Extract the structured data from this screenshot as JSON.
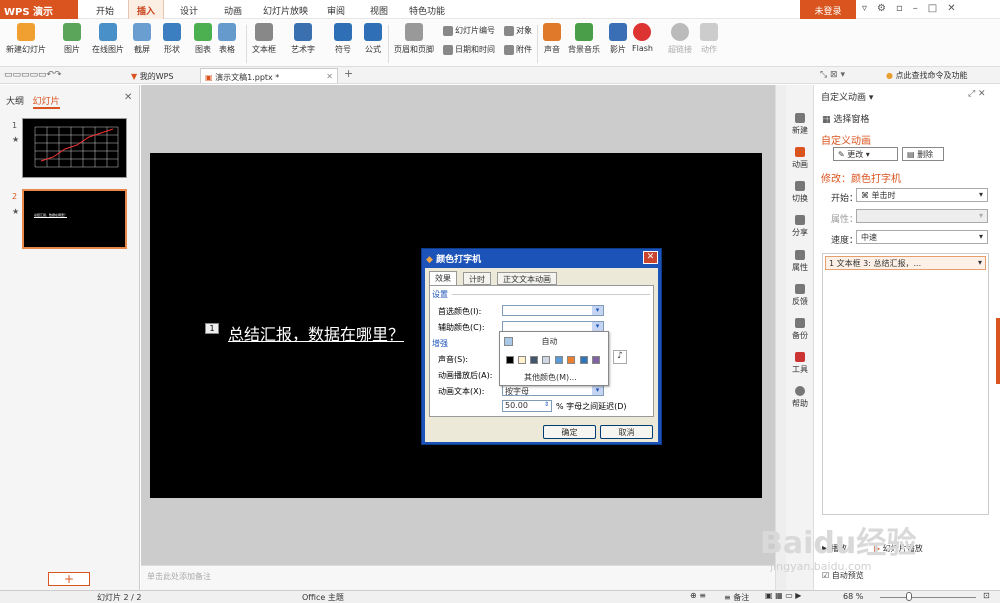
{
  "app": {
    "name": "WPS 演示",
    "login": "未登录"
  },
  "menu": [
    "开始",
    "插入",
    "设计",
    "动画",
    "幻灯片放映",
    "审阅",
    "视图",
    "特色功能"
  ],
  "ribbon": {
    "big": [
      "新建幻灯片",
      "图片",
      "在线图片",
      "截屏",
      "形状",
      "图表",
      "表格",
      "文本框",
      "艺术字",
      "符号",
      "公式",
      "页眉和页脚"
    ],
    "small": [
      "幻灯片编号",
      "对象",
      "日期和时间",
      "附件"
    ],
    "media": [
      "声音",
      "背景音乐",
      "影片",
      "Flash",
      "超链接",
      "动作"
    ]
  },
  "tabs": {
    "my_wps": "我的WPS",
    "doc": "演示文稿1.pptx *",
    "help": "点此查找命令及功能"
  },
  "left_pane": {
    "tab_outline": "大纲",
    "tab_slides": "幻灯片",
    "slide1_num": "1",
    "slide2_num": "2",
    "slide2_text": "总结汇报，数据在哪里？"
  },
  "slide": {
    "badge": "1",
    "text": "总结汇报，数据在哪里？"
  },
  "notes_placeholder": "单击此处添加备注",
  "sidebar": [
    "新建",
    "动画",
    "切换",
    "分享",
    "属性",
    "反馈",
    "备份",
    "工具",
    "帮助"
  ],
  "right_pane": {
    "title": "自定义动画",
    "select_pane": "选择窗格",
    "section": "自定义动画",
    "change_btn": "更改",
    "delete_btn": "删除",
    "modify": "修改：颜色打字机",
    "start_label": "开始：",
    "start_value": "单击时",
    "prop_label": "属性：",
    "speed_label": "速度：",
    "speed_value": "中速",
    "item": "1  文本框 3: 总结汇报，...",
    "play": "播放",
    "slideshow": "幻灯片播放",
    "autopreview": "自动预览"
  },
  "dialog": {
    "title": "颜色打字机",
    "tabs": [
      "效果",
      "计时",
      "正文文本动画"
    ],
    "settings": "设置",
    "primary_color": "首选颜色(I):",
    "secondary_color": "辅助颜色(C):",
    "enhance": "增强",
    "sound": "声音(S):",
    "after_anim": "动画播放后(A):",
    "anim_text": "动画文本(X):",
    "anim_text_value": "按字母",
    "delay_value": "50.00",
    "delay_label": "% 字母之间延迟(D)",
    "ok": "确定",
    "cancel": "取消"
  },
  "color_popup": {
    "auto": "自动",
    "more": "其他颜色(M)...",
    "swatches": [
      "#000000",
      "#fff2cc",
      "#44546a",
      "#d0d8e6",
      "#5b9bd5",
      "#ed7d31",
      "#2e75b6",
      "#8064a2"
    ]
  },
  "status": {
    "slide_info": "幻灯片 2 / 2",
    "theme": "Office 主题",
    "notes": "备注",
    "zoom": "68 %"
  },
  "watermark": {
    "brand": "Baidu经验",
    "url": "jingyan.baidu.com"
  }
}
